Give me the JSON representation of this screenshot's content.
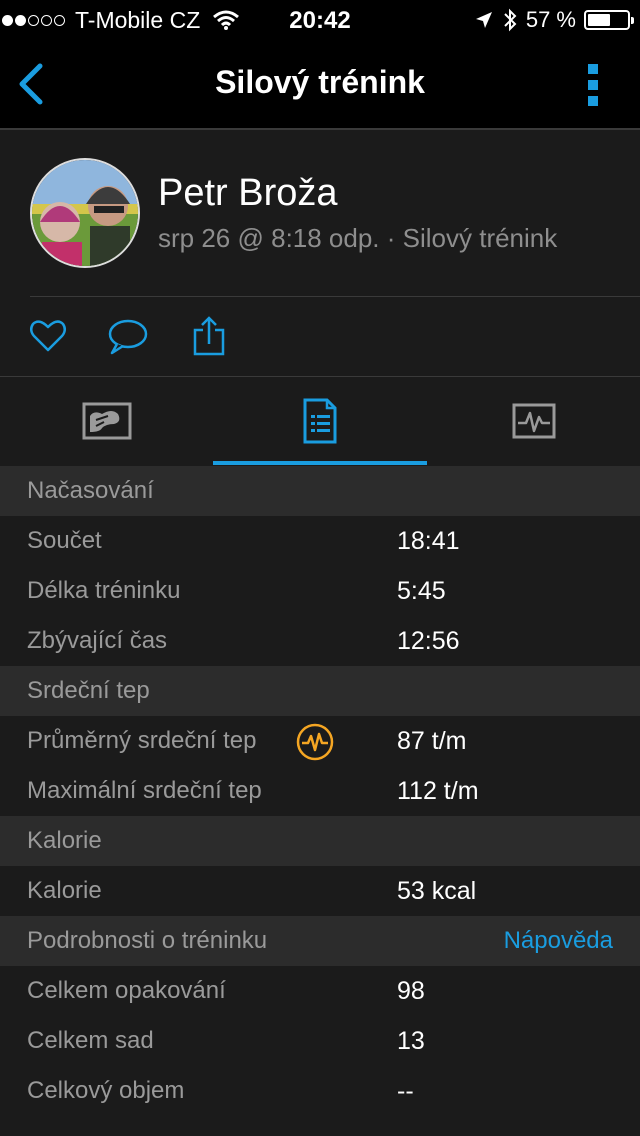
{
  "status_bar": {
    "carrier": "T-Mobile CZ",
    "time": "20:42",
    "battery_percent": "57 %",
    "battery_level": 0.57,
    "signal_bars_filled": 2,
    "signal_bars_total": 5
  },
  "nav": {
    "title": "Silový trénink"
  },
  "profile": {
    "name": "Petr Broža",
    "meta": "srp 26 @ 8:18 odp. · Silový trénink"
  },
  "actions": [
    "heart-icon",
    "comment-icon",
    "share-icon"
  ],
  "tabs": [
    {
      "icon": "map-icon",
      "active": false
    },
    {
      "icon": "details-icon",
      "active": true
    },
    {
      "icon": "chart-icon",
      "active": false
    }
  ],
  "sections": {
    "timing": {
      "title": "Načasování",
      "rows": [
        {
          "label": "Součet",
          "value": "18:41"
        },
        {
          "label": "Délka tréninku",
          "value": "5:45"
        },
        {
          "label": "Zbývající čas",
          "value": "12:56"
        }
      ]
    },
    "heart_rate": {
      "title": "Srdeční tep",
      "rows": [
        {
          "label": "Průměrný srdeční tep",
          "value": "87 t/m"
        },
        {
          "label": "Maximální srdeční tep",
          "value": "112 t/m"
        }
      ]
    },
    "calories": {
      "title": "Kalorie",
      "rows": [
        {
          "label": "Kalorie",
          "value": "53 kcal"
        }
      ]
    },
    "details": {
      "title": "Podrobnosti o tréninku",
      "help_link": "Nápověda",
      "rows": [
        {
          "label": "Celkem opakování",
          "value": "98"
        },
        {
          "label": "Celkem sad",
          "value": "13"
        },
        {
          "label": "Celkový objem",
          "value": "--"
        }
      ]
    }
  },
  "colors": {
    "accent": "#1a9de0",
    "background": "#1b1b1b",
    "section_header": "#2c2c2c",
    "hr_icon": "#f5a623"
  }
}
